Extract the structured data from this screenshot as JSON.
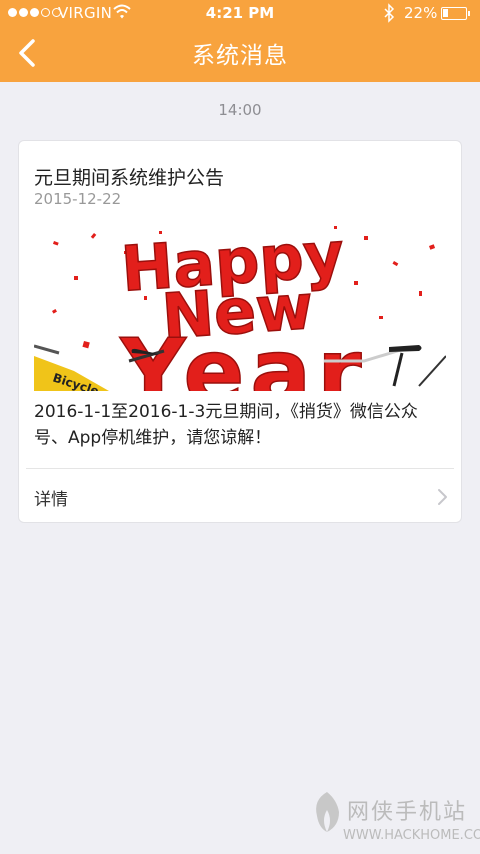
{
  "status_bar": {
    "carrier": "VIRGIN",
    "time": "4:21 PM",
    "battery": "22%",
    "battery_level": 0.22,
    "signal_bars_filled": 3,
    "signal_bars_total": 5
  },
  "header": {
    "title": "系统消息",
    "back_icon": "back-arrow-icon",
    "color": "#f8a33e"
  },
  "messages": [
    {
      "time": "14:00",
      "title": "元旦期间系统维护公告",
      "date": "2015-12-22",
      "banner": {
        "line1": "Happy",
        "line2": "New",
        "line3": "Year",
        "bike_text": "Bicycle"
      },
      "body": "2016-1-1至2016-1-3元旦期间，《捎货》微信公众号、App停机维护，请您谅解！",
      "detail_label": "详情",
      "detail_icon": "chevron-right-icon"
    }
  ],
  "watermark": {
    "name": "网侠手机站",
    "url": "WWW.HACKHOME.COM"
  }
}
